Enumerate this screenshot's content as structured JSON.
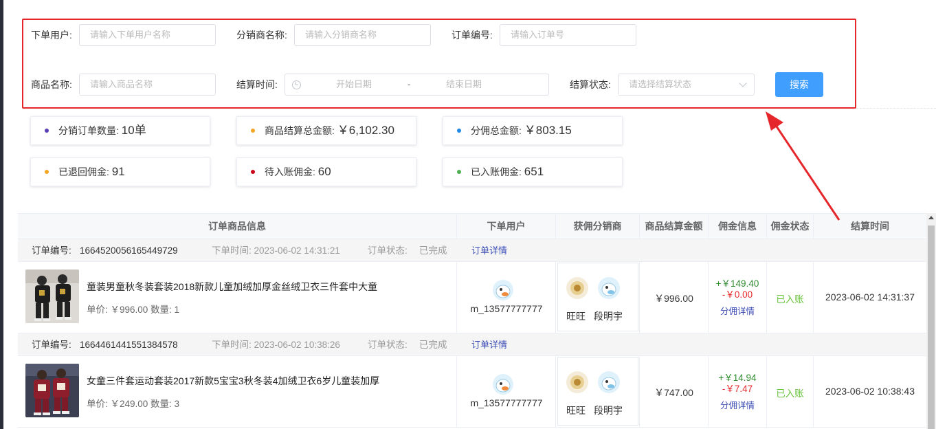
{
  "filters": {
    "user_label": "下单用户:",
    "user_placeholder": "请输入下单用户名称",
    "distributor_label": "分销商名称:",
    "distributor_placeholder": "请输入分销商名称",
    "order_no_label": "订单编号:",
    "order_no_placeholder": "请输入订单号",
    "product_label": "商品名称:",
    "product_placeholder": "请输入商品名称",
    "settle_time_label": "结算时间:",
    "start_placeholder": "开始日期",
    "range_separator": "-",
    "end_placeholder": "结束日期",
    "settle_status_label": "结算状态:",
    "settle_status_placeholder": "请选择结算状态",
    "search_button": "搜索"
  },
  "stats": [
    {
      "label": "分销订单数量:",
      "value": "10单",
      "dot_color": "#5b3fb5"
    },
    {
      "label": "商品结算总金额:",
      "value": "￥6,102.30",
      "dot_color": "#f5a623"
    },
    {
      "label": "分佣总金额:",
      "value": "￥803.15",
      "dot_color": "#1e88e5"
    },
    {
      "label": "已退回佣金:",
      "value": "91",
      "dot_color": "#f5a623"
    },
    {
      "label": "待入账佣金:",
      "value": "60",
      "dot_color": "#d0021b"
    },
    {
      "label": "已入账佣金:",
      "value": "651",
      "dot_color": "#4caf50"
    }
  ],
  "table": {
    "headers": [
      "订单商品信息",
      "下单用户",
      "获佣分销商",
      "商品结算金额",
      "佣金信息",
      "佣金状态",
      "结算时间"
    ],
    "orders": [
      {
        "order_no_label": "订单编号:",
        "order_no": "1664520056165449729",
        "order_time": "下单时间: 2023-06-02 14:31:21",
        "order_status_label": "订单状态:",
        "order_status": "已完成",
        "detail_link": "订单详情",
        "product_name": "童装男童秋冬装套装2018新款儿童加绒加厚金丝绒卫衣三件套中大童",
        "price_qty": "单价: ￥996.00 数量: 1",
        "user": "m_13577777777",
        "distributors": [
          "旺旺",
          "段明宇"
        ],
        "settle_amount": "￥996.00",
        "commission_plus": "+￥149.40",
        "commission_minus": "-￥0.00",
        "commission_link": "分佣详情",
        "commission_status": "已入账",
        "settle_time": "2023-06-02 14:31:37"
      },
      {
        "order_no_label": "订单编号:",
        "order_no": "1664461441551384578",
        "order_time": "下单时间: 2023-06-02 10:38:26",
        "order_status_label": "订单状态:",
        "order_status": "已完成",
        "detail_link": "订单详情",
        "product_name": "女童三件套运动套装2017新款5宝宝3秋冬装4加绒卫衣6岁儿童装加厚",
        "price_qty": "单价: ￥249.00 数量: 3",
        "user": "m_13577777777",
        "distributors": [
          "旺旺",
          "段明宇"
        ],
        "settle_amount": "￥747.00",
        "commission_plus": "+￥14.94",
        "commission_minus": "-￥7.47",
        "commission_link": "分佣详情",
        "commission_status": "已入账",
        "settle_time": "2023-06-02 10:38:43"
      }
    ]
  },
  "colors": {
    "primary": "#409eff",
    "highlight_border": "#e5262b",
    "plus": "#2e8b2e",
    "minus": "#e5262b",
    "status_ok": "#67c23a",
    "link": "#3a4bb5"
  }
}
